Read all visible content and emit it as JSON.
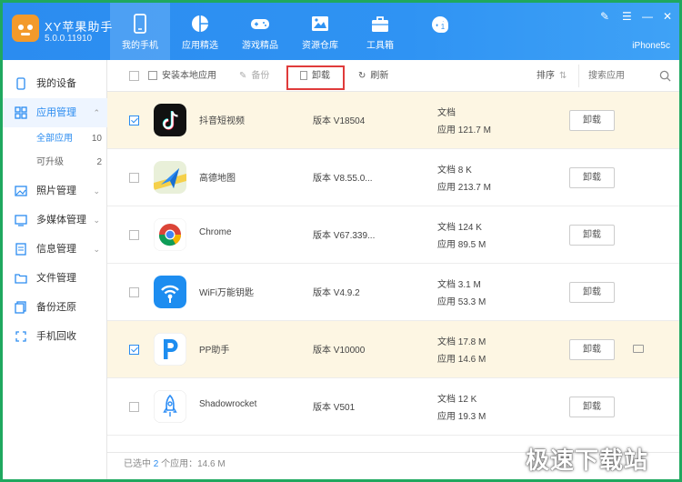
{
  "app": {
    "title": "XY苹果助手",
    "version": "5.0.0.11910",
    "device": "iPhone5c"
  },
  "nav": {
    "tabs": [
      {
        "label": "我的手机",
        "icon": "phone-icon"
      },
      {
        "label": "应用精选",
        "icon": "apps-pie-icon"
      },
      {
        "label": "游戏精品",
        "icon": "gamepad-icon"
      },
      {
        "label": "资源仓库",
        "icon": "image-icon"
      },
      {
        "label": "工具箱",
        "icon": "toolbox-icon"
      },
      {
        "label": "",
        "icon": "check-badge-icon",
        "badge": "1"
      }
    ]
  },
  "sidebar": {
    "items": [
      {
        "label": "我的设备",
        "icon": "device-icon"
      },
      {
        "label": "应用管理",
        "icon": "grid-icon"
      },
      {
        "label": "照片管理",
        "icon": "photo-icon"
      },
      {
        "label": "多媒体管理",
        "icon": "media-icon"
      },
      {
        "label": "信息管理",
        "icon": "message-icon"
      },
      {
        "label": "文件管理",
        "icon": "folder-icon"
      },
      {
        "label": "备份还原",
        "icon": "backup-icon"
      },
      {
        "label": "手机回收",
        "icon": "recycle-icon"
      }
    ],
    "subitems": [
      {
        "label": "全部应用",
        "count": "10"
      },
      {
        "label": "可升级",
        "count": "2"
      }
    ]
  },
  "toolbar": {
    "install_local": "安装本地应用",
    "backup": "备份",
    "uninstall": "卸载",
    "refresh": "刷新",
    "sort": "排序",
    "search_placeholder": "搜索应用"
  },
  "apps": [
    {
      "name": "抖音短视频",
      "version": "版本 V18504",
      "doc": "文档",
      "app_size": "应用 121.7 M",
      "selected": true,
      "action": "卸载",
      "icon": "tiktok-icon",
      "color": "#111111"
    },
    {
      "name": "高德地图",
      "version": "版本 V8.55.0...",
      "doc": "文档 8 K",
      "app_size": "应用 213.7 M",
      "selected": false,
      "action": "卸载",
      "icon": "map-icon",
      "color": "#2e8ef5"
    },
    {
      "name": "Chrome",
      "version": "版本 V67.339...",
      "doc": "文档 124 K",
      "app_size": "应用 89.5 M",
      "selected": false,
      "action": "卸载",
      "icon": "chrome-icon",
      "color": "#ffffff"
    },
    {
      "name": "WiFi万能钥匙",
      "version": "版本 V4.9.2",
      "doc": "文档 3.1 M",
      "app_size": "应用 53.3 M",
      "selected": false,
      "action": "卸载",
      "icon": "wifi-key-icon",
      "color": "#1d8df0"
    },
    {
      "name": "PP助手",
      "version": "版本 V10000",
      "doc": "文档 17.8 M",
      "app_size": "应用 14.6 M",
      "selected": true,
      "action": "卸载",
      "icon": "pp-icon",
      "color": "#ffffff"
    },
    {
      "name": "Shadowrocket",
      "version": "版本 V501",
      "doc": "文档 12 K",
      "app_size": "应用 19.3 M",
      "selected": false,
      "action": "卸载",
      "icon": "rocket-icon",
      "color": "#ffffff"
    }
  ],
  "footer": {
    "prefix": "已选中 ",
    "selected": "2",
    "middle": " 个应用：",
    "size": "14.6 M"
  },
  "watermark": "极速下载站"
}
